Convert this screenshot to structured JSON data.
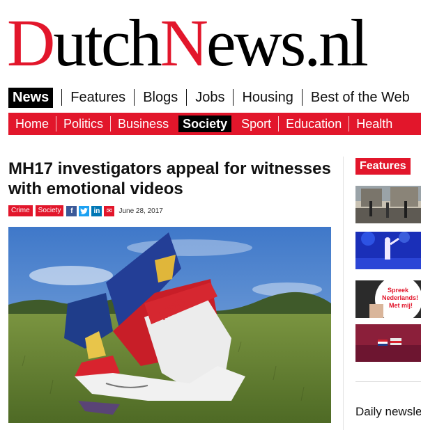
{
  "logo": {
    "part1": "D",
    "part2": "utch",
    "part3": "N",
    "part4": "ews.nl"
  },
  "primary_nav": {
    "news": "News",
    "items": [
      "Features",
      "Blogs",
      "Jobs",
      "Housing",
      "Best of the Web"
    ]
  },
  "section_nav": {
    "items": [
      "Home",
      "Politics",
      "Business",
      "Society",
      "Sport",
      "Education",
      "Health"
    ],
    "active": "Society"
  },
  "article": {
    "headline": "MH17 investigators appeal for witnesses with emotional videos",
    "tags": [
      "Crime",
      "Society"
    ],
    "date": "June 28, 2017",
    "share": {
      "facebook": "f",
      "twitter": "t",
      "linkedin": "in",
      "email": "✉"
    }
  },
  "sidebar": {
    "features_label": "Features",
    "newsletter_label": "Daily newsletter"
  },
  "colors": {
    "brand_red": "#e2162b",
    "black": "#000000"
  }
}
